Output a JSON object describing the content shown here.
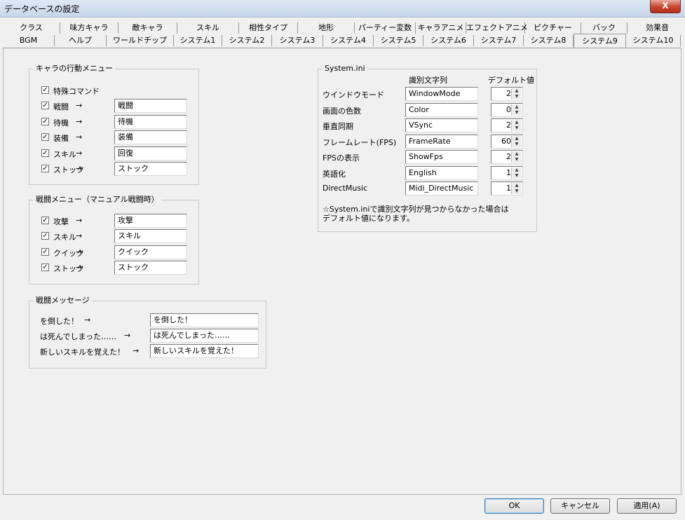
{
  "window": {
    "title": "データベースの設定",
    "close_label": "X"
  },
  "tabs": {
    "row1": [
      "クラス",
      "味方キャラ",
      "敵キャラ",
      "スキル",
      "相性タイプ",
      "地形",
      "パーティー変数",
      "キャラアニメ",
      "エフェクトアニメ",
      "ピクチャー",
      "バック",
      "効果音"
    ],
    "row2": [
      "BGM",
      "ヘルプ",
      "ワールドチップ",
      "システム1",
      "システム2",
      "システム3",
      "システム4",
      "システム5",
      "システム6",
      "システム7",
      "システム8",
      "システム9",
      "システム10"
    ],
    "selected": "システム9"
  },
  "action_menu": {
    "title": "キャラの行動メニュー",
    "items": [
      {
        "label": "特殊コマンド",
        "checked": true,
        "arrow": "",
        "value": null
      },
      {
        "label": "戦闘",
        "checked": true,
        "arrow": "→",
        "value": "戦闘"
      },
      {
        "label": "待機",
        "checked": true,
        "arrow": "→",
        "value": "待機"
      },
      {
        "label": "装備",
        "checked": true,
        "arrow": "→",
        "value": "装備"
      },
      {
        "label": "スキル",
        "checked": true,
        "arrow": "→",
        "value": "回復"
      },
      {
        "label": "ストック",
        "checked": true,
        "arrow": "→",
        "value": "ストック"
      }
    ]
  },
  "battle_menu": {
    "title": "戦闘メニュー（マニュアル戦闘時）",
    "items": [
      {
        "label": "攻撃",
        "checked": true,
        "arrow": "→",
        "value": "攻撃"
      },
      {
        "label": "スキル",
        "checked": true,
        "arrow": "→",
        "value": "スキル"
      },
      {
        "label": "クイック",
        "checked": true,
        "arrow": "→",
        "value": "クイック"
      },
      {
        "label": "ストック",
        "checked": true,
        "arrow": "→",
        "value": "ストック"
      }
    ]
  },
  "battle_messages": {
    "title": "戦闘メッセージ",
    "items": [
      {
        "label": "を倒した！",
        "arrow": "→",
        "value": "を倒した！"
      },
      {
        "label": "は死んでしまった……",
        "arrow": "→",
        "value": "は死んでしまった……"
      },
      {
        "label": "新しいスキルを覚えた！",
        "arrow": "→",
        "value": "新しいスキルを覚えた！"
      }
    ]
  },
  "system_ini": {
    "title": "System.ini",
    "col_id": "識別文字列",
    "col_default": "デフォルト値",
    "items": [
      {
        "label": "ウインドウモード",
        "id": "WindowMode",
        "default": "2"
      },
      {
        "label": "画面の色数",
        "id": "Color",
        "default": "0"
      },
      {
        "label": "垂直同期",
        "id": "VSync",
        "default": "2"
      },
      {
        "label": "フレームレート(FPS)",
        "id": "FrameRate",
        "default": "60"
      },
      {
        "label": "FPSの表示",
        "id": "ShowFps",
        "default": "2"
      },
      {
        "label": "英語化",
        "id": "English",
        "default": "1"
      },
      {
        "label": "DirectMusic",
        "id": "Midi_DirectMusic",
        "default": "1"
      }
    ],
    "note_line1": "☆System.iniで識別文字列が見つからなかった場合は",
    "note_line2": "デフォルト値になります。"
  },
  "buttons": {
    "ok": "OK",
    "cancel": "キャンセル",
    "apply": "適用(A)"
  },
  "icons": {
    "check": "✓",
    "spin_up": "▲",
    "spin_down": "▼"
  }
}
